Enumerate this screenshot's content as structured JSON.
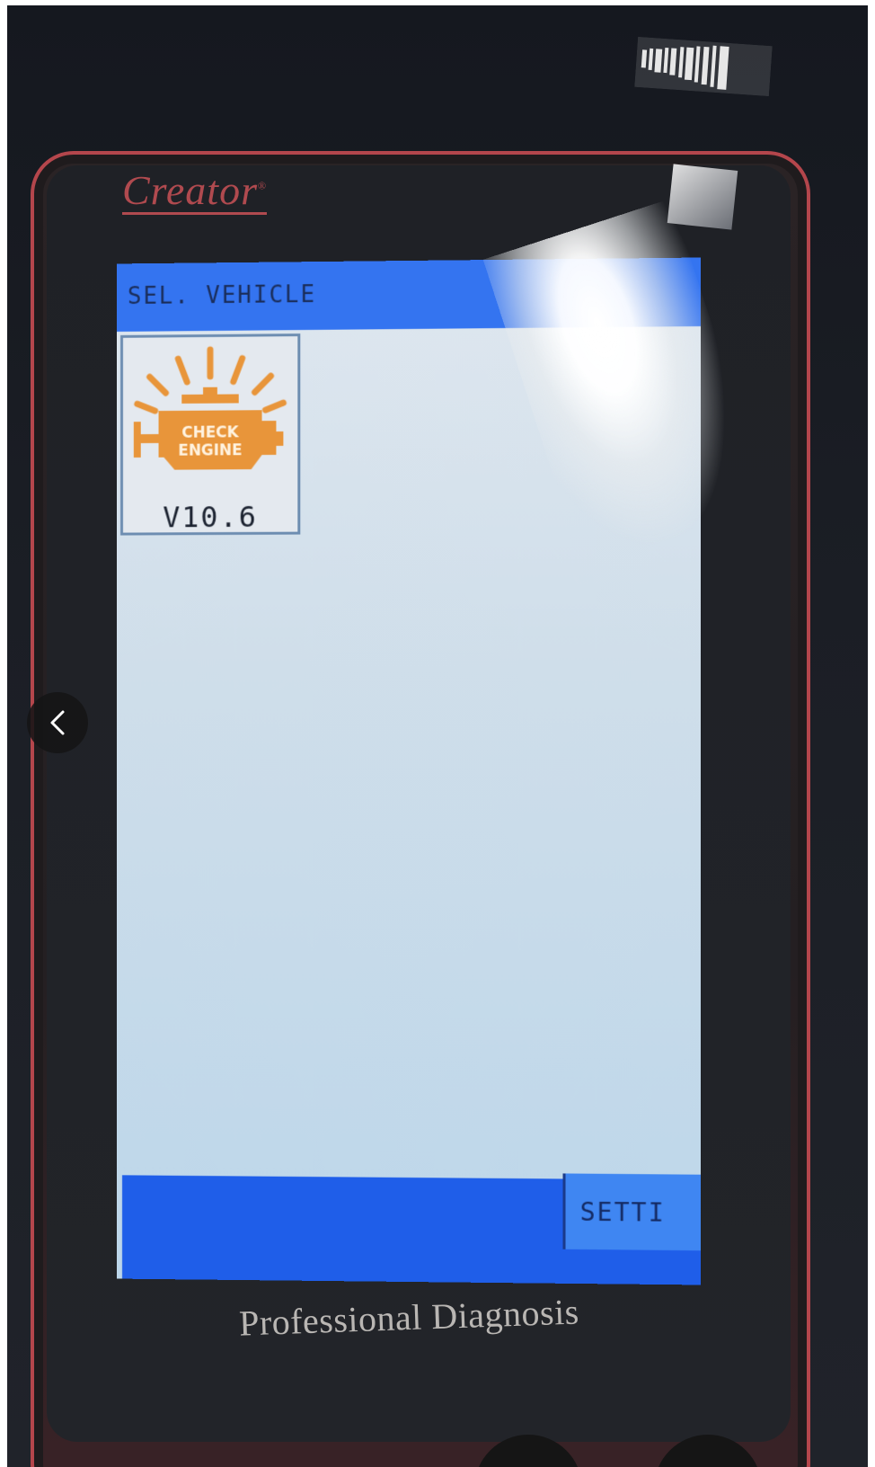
{
  "device": {
    "brand": "Creator",
    "footer_text": "Professional Diagnosis"
  },
  "screen": {
    "title": "SEL. VEHICLE",
    "apps": [
      {
        "icon": "check-engine-icon",
        "icon_text_line1": "CHECK",
        "icon_text_line2": "ENGINE",
        "version": "V10.6"
      }
    ],
    "bottom_bar": {
      "settings_label": "SETTI"
    }
  },
  "viewer": {
    "back_icon": "chevron-left-icon"
  },
  "colors": {
    "title_bar": "#3474f0",
    "bottom_bar": "#1f5ee9",
    "settings_key": "#3f86f2",
    "screen_bg": "#cfdeea",
    "device_trim": "#b4464c",
    "engine_icon": "#e8953a"
  }
}
